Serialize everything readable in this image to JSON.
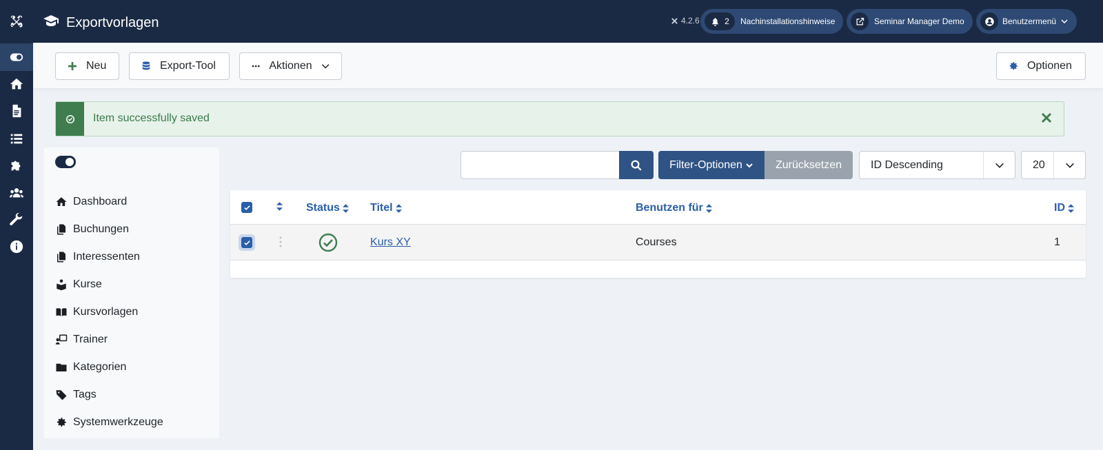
{
  "sidebar_icons": [
    "toggle-icon",
    "home-icon",
    "content-icon",
    "list-icon",
    "puzzle-icon",
    "users-icon",
    "wrench-icon",
    "info-icon"
  ],
  "header": {
    "title": "Exportvorlagen",
    "version": "4.2.6",
    "notifications_count": "2",
    "notifications_label": "Nachinstallationshinweise",
    "site_label": "Seminar Manager Demo",
    "user_menu_label": "Benutzermenü"
  },
  "toolbar": {
    "new_label": "Neu",
    "export_tool_label": "Export-Tool",
    "actions_label": "Aktionen",
    "options_label": "Optionen"
  },
  "alert": {
    "message": "Item successfully saved"
  },
  "content_nav": {
    "items": [
      {
        "label": "Dashboard",
        "icon": "home-icon"
      },
      {
        "label": "Buchungen",
        "icon": "copy-icon"
      },
      {
        "label": "Interessenten",
        "icon": "copy-icon"
      },
      {
        "label": "Kurse",
        "icon": "reader-icon"
      },
      {
        "label": "Kursvorlagen",
        "icon": "book-icon"
      },
      {
        "label": "Trainer",
        "icon": "teacher-icon"
      },
      {
        "label": "Kategorien",
        "icon": "folder-icon"
      },
      {
        "label": "Tags",
        "icon": "tag-icon"
      },
      {
        "label": "Systemwerkzeuge",
        "icon": "gear-icon"
      }
    ]
  },
  "filters": {
    "search_placeholder": "",
    "filter_options_label": "Filter-Optionen",
    "reset_label": "Zurücksetzen",
    "ordering_value": "ID Descending",
    "limit_value": "20"
  },
  "table": {
    "headers": {
      "status": "Status",
      "title": "Titel",
      "used_for": "Benutzen für",
      "id": "ID"
    },
    "rows": [
      {
        "title": "Kurs XY",
        "used_for": "Courses",
        "id": "1",
        "status": "published",
        "checked": true
      }
    ]
  },
  "colors": {
    "sidebar_bg": "#1b2a44",
    "primary": "#2f5384",
    "link": "#2a5ea8",
    "success": "#3f7d4e"
  }
}
